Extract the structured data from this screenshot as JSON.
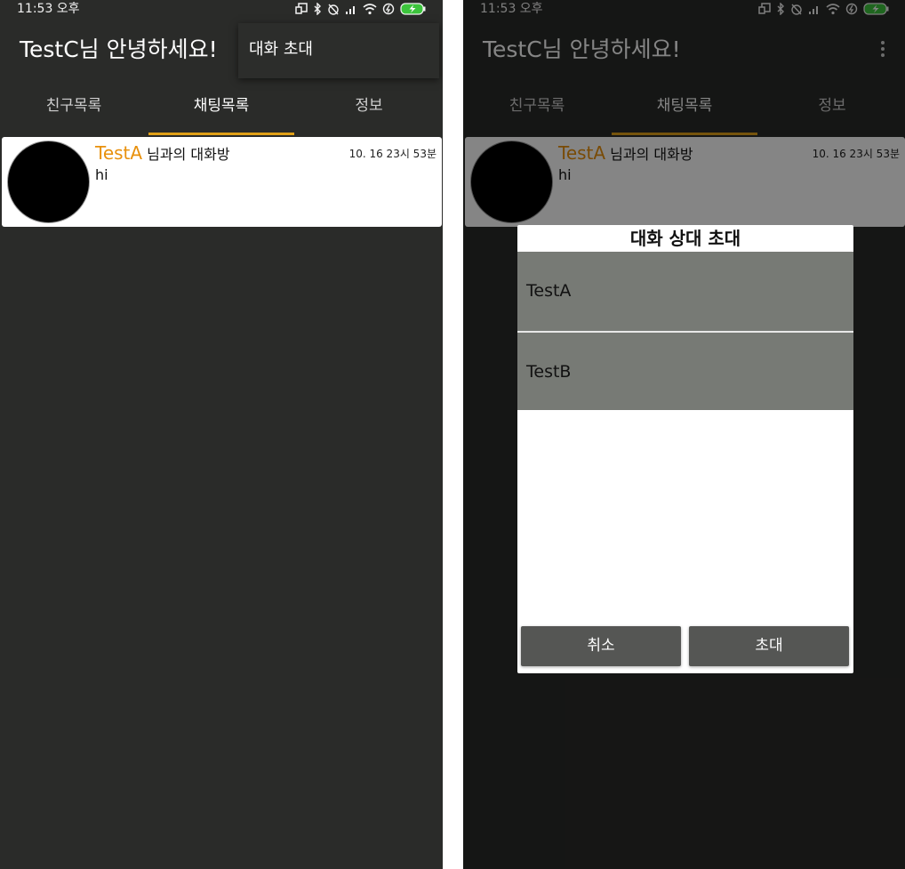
{
  "status_bar": {
    "time": "11:53 오후"
  },
  "app_bar": {
    "title": "TestC님 안녕하세요!"
  },
  "overflow_menu": {
    "items": [
      "대화 초대"
    ]
  },
  "tabs": [
    {
      "label": "친구목록",
      "active": false
    },
    {
      "label": "채팅목록",
      "active": true
    },
    {
      "label": "정보",
      "active": false
    }
  ],
  "chat_list": [
    {
      "partner": "TestA",
      "title_suffix": " 님과의 대화방",
      "time": "10. 16 23시 53분",
      "last_message": "hi"
    }
  ],
  "invite_dialog": {
    "title": "대화 상대 초대",
    "friends": [
      "TestA",
      "TestB"
    ],
    "cancel_label": "취소",
    "invite_label": "초대"
  },
  "colors": {
    "accent": "#e0a017",
    "partner_name": "#e8900c",
    "background": "#2a2b29",
    "list_option": "#777a75",
    "dialog_button": "#555654"
  }
}
